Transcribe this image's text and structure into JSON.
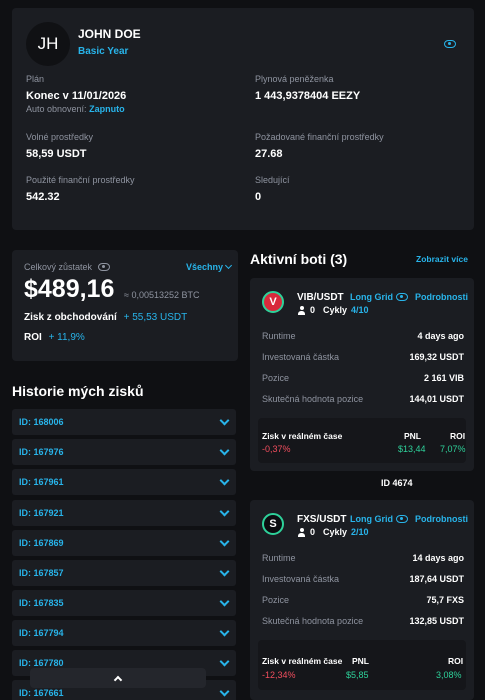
{
  "profile": {
    "initials": "JH",
    "name": "JOHN DOE",
    "plan_badge": "Basic Year",
    "plan_label": "Plán",
    "plan_value": "Konec v 11/01/2026",
    "auto_renew_label": "Auto obnovení:",
    "auto_renew_value": "Zapnuto",
    "wallet_label": "Plynová peněženka",
    "wallet_value": "1 443,9378404 EEZY",
    "free_label": "Volné prostředky",
    "free_value": "58,59 USDT",
    "required_label": "Požadované finanční prostředky",
    "required_value": "27.68",
    "used_label": "Použité finanční prostředky",
    "used_value": "542.32",
    "followers_label": "Sledující",
    "followers_value": "0"
  },
  "balance": {
    "label": "Celkový zůstatek",
    "filter": "Všechny",
    "amount": "$489,16",
    "btc": "≈ 0,00513252 BTC",
    "profit_label": "Zisk z obchodování",
    "profit_value": "+ 55,53 USDT",
    "roi_label": "ROI",
    "roi_value": "+ 11,9%"
  },
  "history": {
    "title": "Historie mých zisků",
    "items": [
      "ID: 168006",
      "ID: 167976",
      "ID: 167961",
      "ID: 167921",
      "ID: 167869",
      "ID: 167857",
      "ID: 167835",
      "ID: 167794",
      "ID: 167780",
      "ID: 167661"
    ]
  },
  "bots": {
    "title": "Aktivní boti (3)",
    "show_more": "Zobrazit více",
    "detail_label": "Podrobnosti",
    "runtime_label": "Runtime",
    "invested_label": "Investovaná částka",
    "position_label": "Pozice",
    "position_value_label": "Skutečná hodnota pozice",
    "realtime_label": "Zisk v reálném čase",
    "pnl_label": "PNL",
    "roi_label": "ROI",
    "cycles_label": "Cykly",
    "separator_id": "ID 4674",
    "list": [
      {
        "logo": "V",
        "logo_color": "#d82a3b",
        "pair": "VIB/USDT",
        "strategy": "Long Grid",
        "followers": "0",
        "cycles": "4/10",
        "runtime": "4 days ago",
        "invested": "169,32 USDT",
        "position": "2 161 VIB",
        "position_value": "144,01 USDT",
        "realtime": "-0,37%",
        "pnl": "$13,44",
        "roi": "7,07%"
      },
      {
        "logo": "S",
        "logo_color": "#0c0d10",
        "pair": "FXS/USDT",
        "strategy": "Long Grid",
        "followers": "0",
        "cycles": "2/10",
        "runtime": "14 days ago",
        "invested": "187,64 USDT",
        "position": "75,7 FXS",
        "position_value": "132,85 USDT",
        "realtime": "-12,34%",
        "pnl": "$5,85",
        "roi": "3,08%"
      }
    ]
  },
  "colors": {
    "accent": "#28b4ea",
    "negative": "#f24e5e",
    "positive": "#2ed19a",
    "card": "#1b1d22",
    "background": "#0f1013"
  }
}
